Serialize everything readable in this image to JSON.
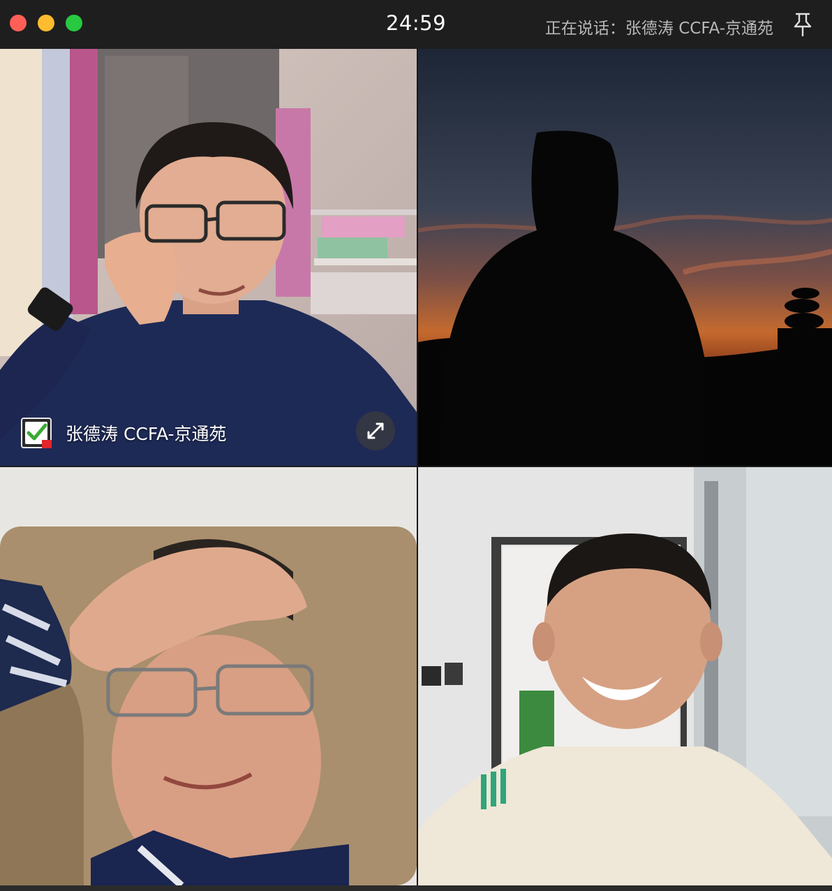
{
  "window": {
    "controls": {
      "close": "close-button",
      "minimize": "minimize-button",
      "zoom": "zoom-button"
    },
    "timer": "24:59",
    "speaking_label": "正在说话：张德涛 CCFA-京通苑",
    "pin_icon": "pin-icon"
  },
  "tiles": [
    {
      "name_label": "张德涛 CCFA-京通苑",
      "status_icon": "check-icon",
      "expand_icon": "expand-arrows-icon",
      "active_speaker": true
    },
    {
      "content": "silhouette against sunset sky"
    },
    {
      "content": "man with hand on forehead, glasses"
    },
    {
      "content": "smiling man in cream hoodie"
    }
  ],
  "colors": {
    "close": "#ff5f57",
    "minimize": "#febc2e",
    "zoom": "#28c840",
    "titlebar": "#1e1e1e",
    "check_green": "#3aaa35"
  }
}
